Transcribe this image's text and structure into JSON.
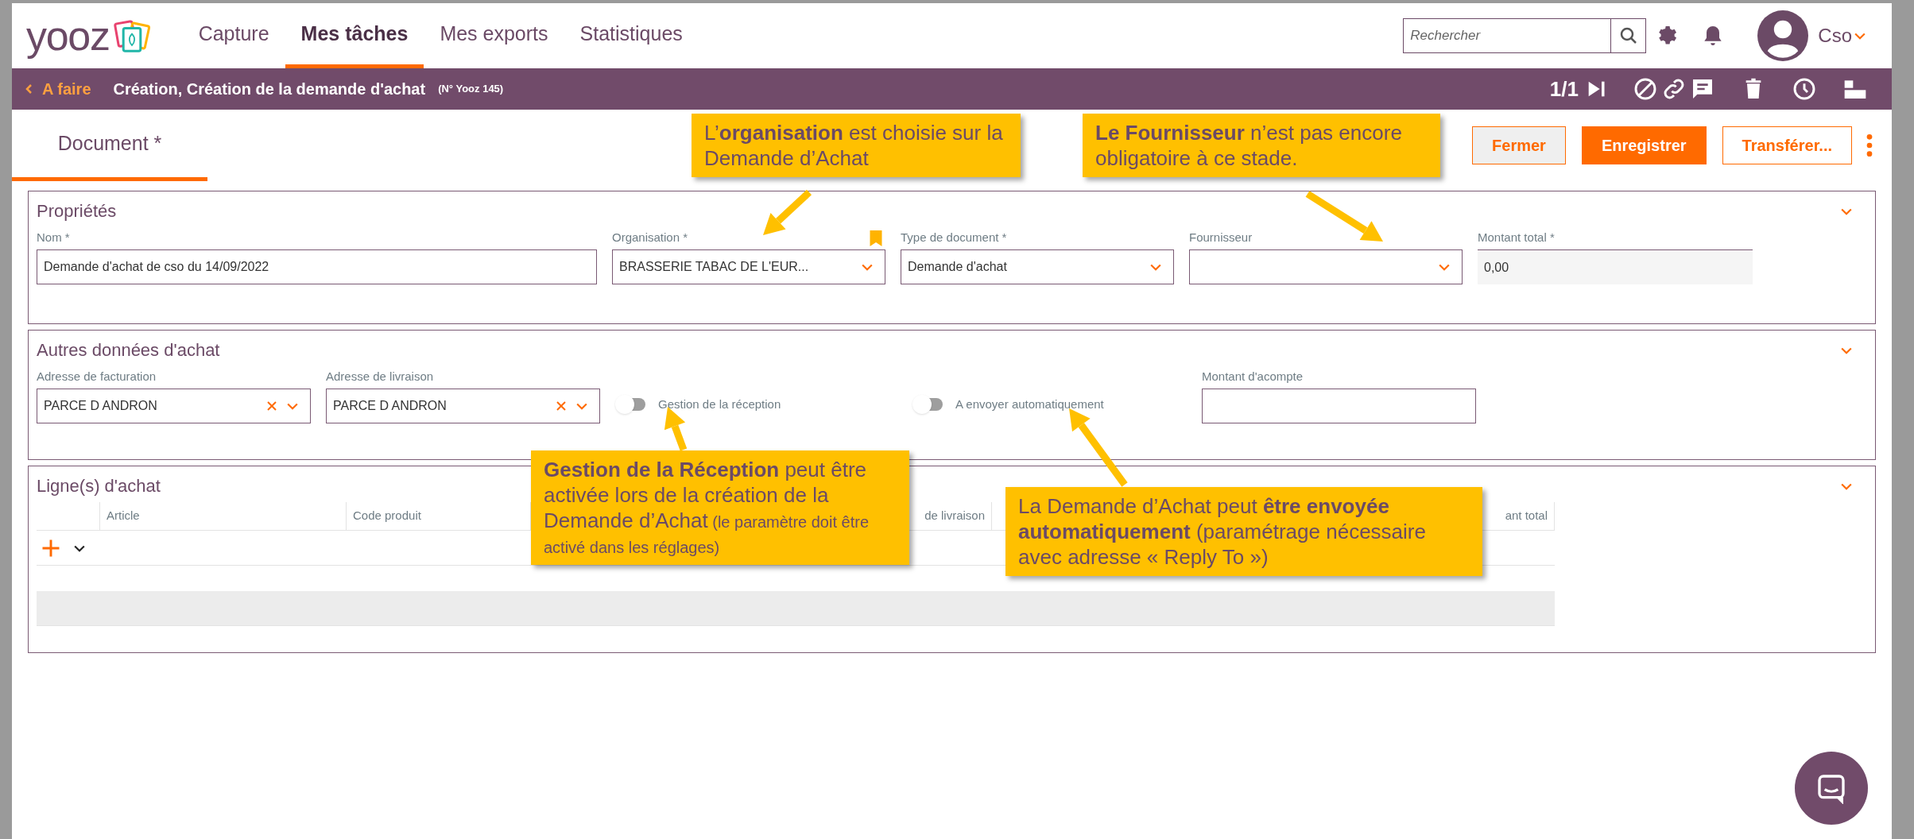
{
  "nav": {
    "logo": "yooz",
    "items": [
      {
        "label": "Capture",
        "selected": false
      },
      {
        "label": "Mes tâches",
        "selected": true
      },
      {
        "label": "Mes exports",
        "selected": false
      },
      {
        "label": "Statistiques",
        "selected": false
      }
    ],
    "search": {
      "placeholder": "Rechercher"
    },
    "user": "Cso"
  },
  "task_bar": {
    "back": "A faire",
    "title": "Création, Création de la demande d'achat",
    "number": "(N° Yooz 145)",
    "pager": "1/1"
  },
  "doc_tabs": [
    {
      "label": "Document *",
      "selected": true
    }
  ],
  "actions": [
    {
      "label": "Fermer",
      "kind": "secondary"
    },
    {
      "label": "Enregistrer",
      "kind": "primary"
    },
    {
      "label": "Transférer...",
      "kind": "outline"
    }
  ],
  "properties": {
    "title": "Propriétés",
    "fields": [
      {
        "label": "Nom *",
        "value": "Demande d'achat de cso du 14/09/2022",
        "kind": "text"
      },
      {
        "label": "Organisation *",
        "value": "BRASSERIE TABAC DE L'EUR...",
        "kind": "select",
        "bookmark": true
      },
      {
        "label": "Type de document *",
        "value": "Demande d'achat",
        "kind": "select"
      },
      {
        "label": "Fournisseur",
        "kind": "select"
      },
      {
        "label": "Montant total *",
        "value": "0,00",
        "kind": "readonly"
      }
    ]
  },
  "other": {
    "title": "Autres données d'achat",
    "fields": [
      {
        "label": "Adresse de facturation",
        "value": "PARCE D ANDRON",
        "kind": "clearable"
      },
      {
        "label": "Adresse de livraison",
        "value": "PARCE D ANDRON",
        "kind": "clearable"
      },
      {
        "label": "Gestion de la réception",
        "kind": "toggle",
        "on": false
      },
      {
        "label": "A envoyer automatiquement",
        "kind": "toggle",
        "on": false
      },
      {
        "label": "Montant d'acompte",
        "kind": "text"
      }
    ]
  },
  "lines": {
    "title": "Ligne(s) d'achat",
    "columns": [
      "Article",
      "Code produit",
      "de livraison",
      "ant total"
    ]
  },
  "callouts": [
    {
      "text": "L’**organisation** est choisie sur la Demande d’Achat"
    },
    {
      "text": "**Le Fournisseur** n’est pas encore obligatoire à ce stade."
    },
    {
      "text": "**Gestion de la Réception** peut être activée lors de la création de la Demande d’Achat",
      "note": "(le paramètre doit être activé dans les réglages)"
    },
    {
      "text": "La Demande d’Achat peut **être envoyée automatiquement** (paramétrage nécessaire avec adresse « Reply To »)"
    }
  ]
}
